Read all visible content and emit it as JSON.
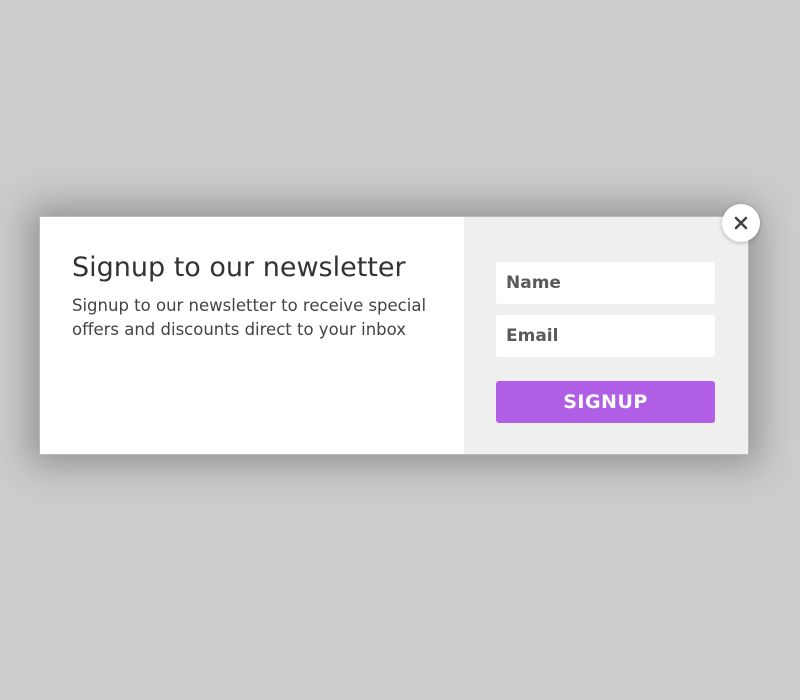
{
  "modal": {
    "title": "Signup to our newsletter",
    "description": "Signup to our newsletter to receive special offers and discounts direct to your inbox",
    "form": {
      "name_placeholder": "Name",
      "email_placeholder": "Email",
      "signup_label": "SIGNUP"
    },
    "close_icon": "close-icon"
  },
  "colors": {
    "backdrop": "#cccccc",
    "modal_left_bg": "#ffffff",
    "modal_right_bg": "#efefef",
    "accent": "#b05ee6",
    "button_text": "#ffffff"
  }
}
